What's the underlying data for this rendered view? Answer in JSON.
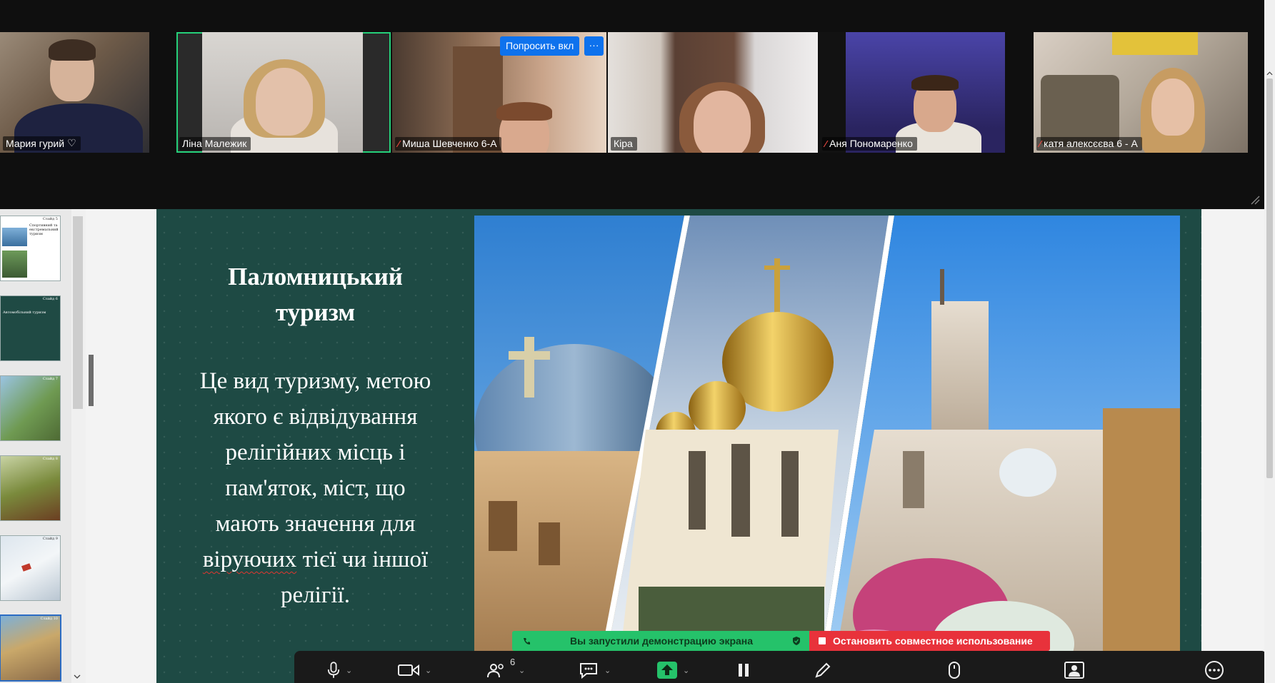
{
  "participants": [
    {
      "name": "Мария гурий",
      "muted": false,
      "heart": true
    },
    {
      "name": "Ліна Малежик",
      "muted": false,
      "active": true
    },
    {
      "name": "Миша Шевченко 6-А",
      "muted": true
    },
    {
      "name": "Кіра",
      "muted": false
    },
    {
      "name": "Аня Пономаренко",
      "muted": true
    },
    {
      "name": "катя алексєєва 6 - А",
      "muted": true
    }
  ],
  "participant_actions": {
    "ask_unmute_label": "Попросить вкл",
    "more_label": "···"
  },
  "slide": {
    "title_line1": "Паломницький",
    "title_line2": "туризм",
    "body_lines": [
      "Це вид туризму, метою",
      "якого є відвідування",
      "релігійних місць і",
      "пам'яток, міст, що",
      "мають значення для",
      "віруючих тієї чи іншої",
      "релігії."
    ],
    "body_misspelled_word": "віруючих",
    "body_line6_rest": " тієї чи іншої"
  },
  "thumbnails": [
    {
      "number": "Слайд 5",
      "text": "Спортивний та екстремальний туризм",
      "selected": false
    },
    {
      "number": "Слайд 6",
      "text": "Автомобільний туризм",
      "selected": false
    },
    {
      "number": "Слайд 7",
      "text": "",
      "selected": false
    },
    {
      "number": "Слайд 8",
      "text": "",
      "selected": false
    },
    {
      "number": "Слайд 9",
      "text": "",
      "selected": false
    },
    {
      "number": "Слайд 10",
      "text": "",
      "selected": true
    }
  ],
  "share_banner": {
    "status_text": "Вы запустили демонстрацию экрана",
    "stop_text": "Остановить совместное использование"
  },
  "toolbar": {
    "participants_count": "6",
    "icons": [
      "microphone-icon",
      "video-icon",
      "participants-icon",
      "chat-icon",
      "share-screen-icon",
      "pause-share-icon",
      "annotate-icon",
      "remote-control-icon",
      "spotlight-icon",
      "more-icon"
    ]
  },
  "colors": {
    "slide_bg": "#1e4a44",
    "active_speaker": "#25d07a",
    "zoom_blue": "#0e72ed",
    "share_green": "#25c26a",
    "stop_red": "#e8323b"
  }
}
